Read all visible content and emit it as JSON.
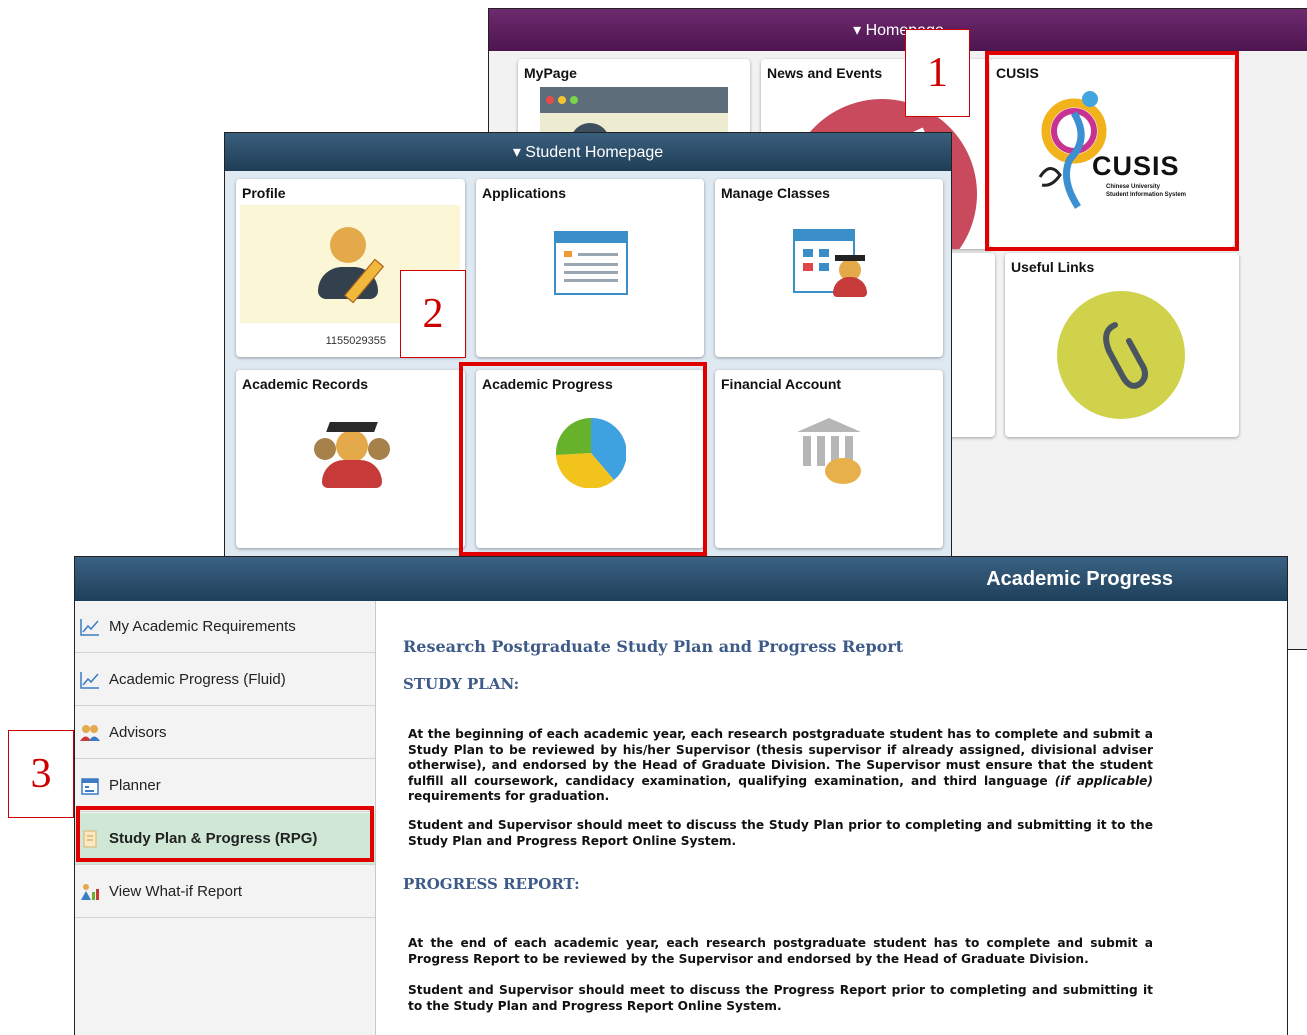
{
  "homepage": {
    "header": "▾ Homepage",
    "tiles": {
      "mypage": "MyPage",
      "news": "News and Events",
      "cusis": "CUSIS",
      "cusis_logo_text": "CUSIS",
      "cusis_logo_sub1": "Chinese University",
      "cusis_logo_sub2": "Student Information System",
      "useful_links": "Useful Links"
    }
  },
  "student_homepage": {
    "header": "▾ Student Homepage",
    "tiles": {
      "profile": "Profile",
      "profile_id": "1155029355",
      "applications": "Applications",
      "manage_classes": "Manage Classes",
      "academic_records": "Academic Records",
      "academic_progress": "Academic Progress",
      "financial_account": "Financial Account"
    }
  },
  "academic_progress_page": {
    "header": "Academic Progress",
    "sidebar": [
      {
        "label": "My Academic Requirements",
        "icon": "chart-line-icon"
      },
      {
        "label": "Academic Progress (Fluid)",
        "icon": "chart-line-icon"
      },
      {
        "label": "Advisors",
        "icon": "people-icon"
      },
      {
        "label": "Planner",
        "icon": "planner-icon"
      },
      {
        "label": "Study Plan & Progress (RPG)",
        "icon": "document-icon",
        "selected": true
      },
      {
        "label": "View What-if Report",
        "icon": "what-if-icon"
      }
    ],
    "content": {
      "title": "Research Postgraduate Study Plan and Progress Report",
      "study_plan_heading": "STUDY PLAN:",
      "study_plan_p1": "At the beginning of each academic year, each research postgraduate student has to complete and submit a Study Plan to be reviewed by his/her Supervisor (thesis supervisor if already assigned, divisional adviser otherwise), and endorsed by the Head of Graduate Division. The Supervisor must ensure that the student fulfill all coursework, candidacy examination, qualifying examination, and third language (if applicable) requirements for graduation.",
      "study_plan_p1_a": "At the beginning of each academic year, each research postgraduate student has to complete and submit a Study Plan to be reviewed by his/her Supervisor (thesis supervisor if already assigned, divisional adviser otherwise), and endorsed by the Head of Graduate Division. The Supervisor must ensure that the student fulfill all coursework, candidacy examination, qualifying examination, and third language ",
      "study_plan_p1_em": "(if applicable)",
      "study_plan_p1_b": " requirements for graduation.",
      "study_plan_p2": "Student and Supervisor should meet to discuss the Study Plan prior to completing and submitting it to the Study Plan and Progress Report Online System.",
      "progress_heading": "PROGRESS REPORT:",
      "progress_p1": "At the end of each academic year, each research postgraduate student has to complete and submit a Progress Report to be reviewed by the Supervisor and endorsed by the Head of Graduate Division.",
      "progress_p2": "Student and Supervisor should meet to discuss the Progress Report prior to completing and submitting it to the Study Plan and Progress Report Online System."
    }
  },
  "step_labels": [
    "1",
    "2",
    "3"
  ],
  "colors": {
    "highlight": "#e00000",
    "homepage_header": "#5a1d5c",
    "student_header": "#2c4b66",
    "selected_item": "#cfe8d6"
  }
}
